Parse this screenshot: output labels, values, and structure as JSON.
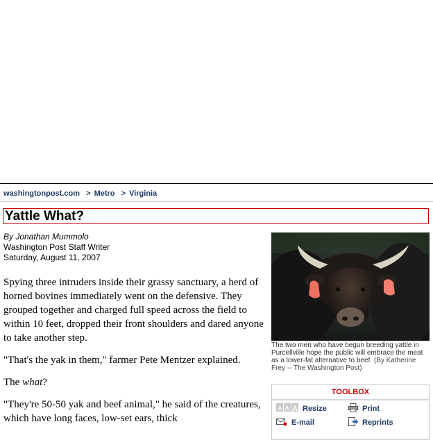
{
  "breadcrumb": {
    "site": "washingtonpost.com",
    "sep1": ">",
    "section": "Metro",
    "sep2": ">",
    "subsection": "Virginia"
  },
  "article": {
    "headline": "Yattle What?",
    "author": "By Jonathan Mummolo",
    "author_role": "Washington Post Staff Writer",
    "date": "Saturday, August 11, 2007",
    "paragraphs": {
      "p1": "Spying three intruders inside their grassy sanctuary, a herd of horned bovines immediately went on the defensive. They grouped together and charged full speed across the field to within 10 feet, dropped their front shoulders and dared anyone to take another step.",
      "p2": "\"That's the yak in them,\" farmer Pete Mentzer explained.",
      "p3_before": "The ",
      "p3_em": "what",
      "p3_after": "?",
      "p4": "\"They're 50-50 yak and beef animal,\" he said of the creatures, which have long faces, low-set ears, thick"
    }
  },
  "photo": {
    "caption": "The two men who have begun breeding yattle in Purcellville hope the public will embrace the meat as a lower-fat alternative to beef.",
    "credit": "(By Katherine Frey -- The Washington Post)"
  },
  "toolbox": {
    "title": "TOOLBOX",
    "resize": "Resize",
    "print": "Print",
    "email": "E-mail",
    "reprints": "Reprints",
    "icons": {
      "resize": "text-resize-icon",
      "print": "printer-icon",
      "email": "envelope-icon",
      "reprints": "reprints-arrow-icon"
    }
  },
  "colors": {
    "headline_border": "#cc0000",
    "link": "#1f3a66",
    "toolbox_title": "#cc0000"
  }
}
